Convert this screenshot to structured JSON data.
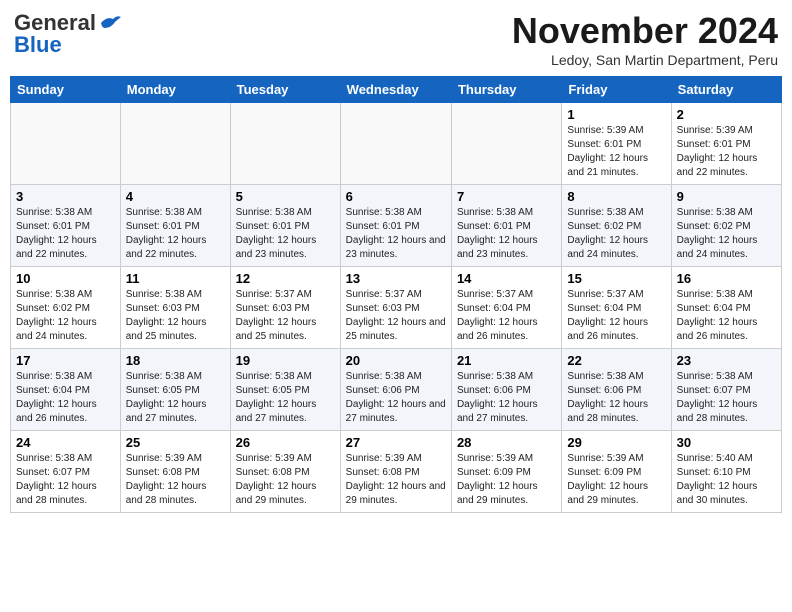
{
  "header": {
    "logo_general": "General",
    "logo_blue": "Blue",
    "month_title": "November 2024",
    "location": "Ledoy, San Martin Department, Peru"
  },
  "days_of_week": [
    "Sunday",
    "Monday",
    "Tuesday",
    "Wednesday",
    "Thursday",
    "Friday",
    "Saturday"
  ],
  "weeks": [
    [
      {
        "day": "",
        "info": ""
      },
      {
        "day": "",
        "info": ""
      },
      {
        "day": "",
        "info": ""
      },
      {
        "day": "",
        "info": ""
      },
      {
        "day": "",
        "info": ""
      },
      {
        "day": "1",
        "info": "Sunrise: 5:39 AM\nSunset: 6:01 PM\nDaylight: 12 hours and 21 minutes."
      },
      {
        "day": "2",
        "info": "Sunrise: 5:39 AM\nSunset: 6:01 PM\nDaylight: 12 hours and 22 minutes."
      }
    ],
    [
      {
        "day": "3",
        "info": "Sunrise: 5:38 AM\nSunset: 6:01 PM\nDaylight: 12 hours and 22 minutes."
      },
      {
        "day": "4",
        "info": "Sunrise: 5:38 AM\nSunset: 6:01 PM\nDaylight: 12 hours and 22 minutes."
      },
      {
        "day": "5",
        "info": "Sunrise: 5:38 AM\nSunset: 6:01 PM\nDaylight: 12 hours and 23 minutes."
      },
      {
        "day": "6",
        "info": "Sunrise: 5:38 AM\nSunset: 6:01 PM\nDaylight: 12 hours and 23 minutes."
      },
      {
        "day": "7",
        "info": "Sunrise: 5:38 AM\nSunset: 6:01 PM\nDaylight: 12 hours and 23 minutes."
      },
      {
        "day": "8",
        "info": "Sunrise: 5:38 AM\nSunset: 6:02 PM\nDaylight: 12 hours and 24 minutes."
      },
      {
        "day": "9",
        "info": "Sunrise: 5:38 AM\nSunset: 6:02 PM\nDaylight: 12 hours and 24 minutes."
      }
    ],
    [
      {
        "day": "10",
        "info": "Sunrise: 5:38 AM\nSunset: 6:02 PM\nDaylight: 12 hours and 24 minutes."
      },
      {
        "day": "11",
        "info": "Sunrise: 5:38 AM\nSunset: 6:03 PM\nDaylight: 12 hours and 25 minutes."
      },
      {
        "day": "12",
        "info": "Sunrise: 5:37 AM\nSunset: 6:03 PM\nDaylight: 12 hours and 25 minutes."
      },
      {
        "day": "13",
        "info": "Sunrise: 5:37 AM\nSunset: 6:03 PM\nDaylight: 12 hours and 25 minutes."
      },
      {
        "day": "14",
        "info": "Sunrise: 5:37 AM\nSunset: 6:04 PM\nDaylight: 12 hours and 26 minutes."
      },
      {
        "day": "15",
        "info": "Sunrise: 5:37 AM\nSunset: 6:04 PM\nDaylight: 12 hours and 26 minutes."
      },
      {
        "day": "16",
        "info": "Sunrise: 5:38 AM\nSunset: 6:04 PM\nDaylight: 12 hours and 26 minutes."
      }
    ],
    [
      {
        "day": "17",
        "info": "Sunrise: 5:38 AM\nSunset: 6:04 PM\nDaylight: 12 hours and 26 minutes."
      },
      {
        "day": "18",
        "info": "Sunrise: 5:38 AM\nSunset: 6:05 PM\nDaylight: 12 hours and 27 minutes."
      },
      {
        "day": "19",
        "info": "Sunrise: 5:38 AM\nSunset: 6:05 PM\nDaylight: 12 hours and 27 minutes."
      },
      {
        "day": "20",
        "info": "Sunrise: 5:38 AM\nSunset: 6:06 PM\nDaylight: 12 hours and 27 minutes."
      },
      {
        "day": "21",
        "info": "Sunrise: 5:38 AM\nSunset: 6:06 PM\nDaylight: 12 hours and 27 minutes."
      },
      {
        "day": "22",
        "info": "Sunrise: 5:38 AM\nSunset: 6:06 PM\nDaylight: 12 hours and 28 minutes."
      },
      {
        "day": "23",
        "info": "Sunrise: 5:38 AM\nSunset: 6:07 PM\nDaylight: 12 hours and 28 minutes."
      }
    ],
    [
      {
        "day": "24",
        "info": "Sunrise: 5:38 AM\nSunset: 6:07 PM\nDaylight: 12 hours and 28 minutes."
      },
      {
        "day": "25",
        "info": "Sunrise: 5:39 AM\nSunset: 6:08 PM\nDaylight: 12 hours and 28 minutes."
      },
      {
        "day": "26",
        "info": "Sunrise: 5:39 AM\nSunset: 6:08 PM\nDaylight: 12 hours and 29 minutes."
      },
      {
        "day": "27",
        "info": "Sunrise: 5:39 AM\nSunset: 6:08 PM\nDaylight: 12 hours and 29 minutes."
      },
      {
        "day": "28",
        "info": "Sunrise: 5:39 AM\nSunset: 6:09 PM\nDaylight: 12 hours and 29 minutes."
      },
      {
        "day": "29",
        "info": "Sunrise: 5:39 AM\nSunset: 6:09 PM\nDaylight: 12 hours and 29 minutes."
      },
      {
        "day": "30",
        "info": "Sunrise: 5:40 AM\nSunset: 6:10 PM\nDaylight: 12 hours and 30 minutes."
      }
    ]
  ]
}
